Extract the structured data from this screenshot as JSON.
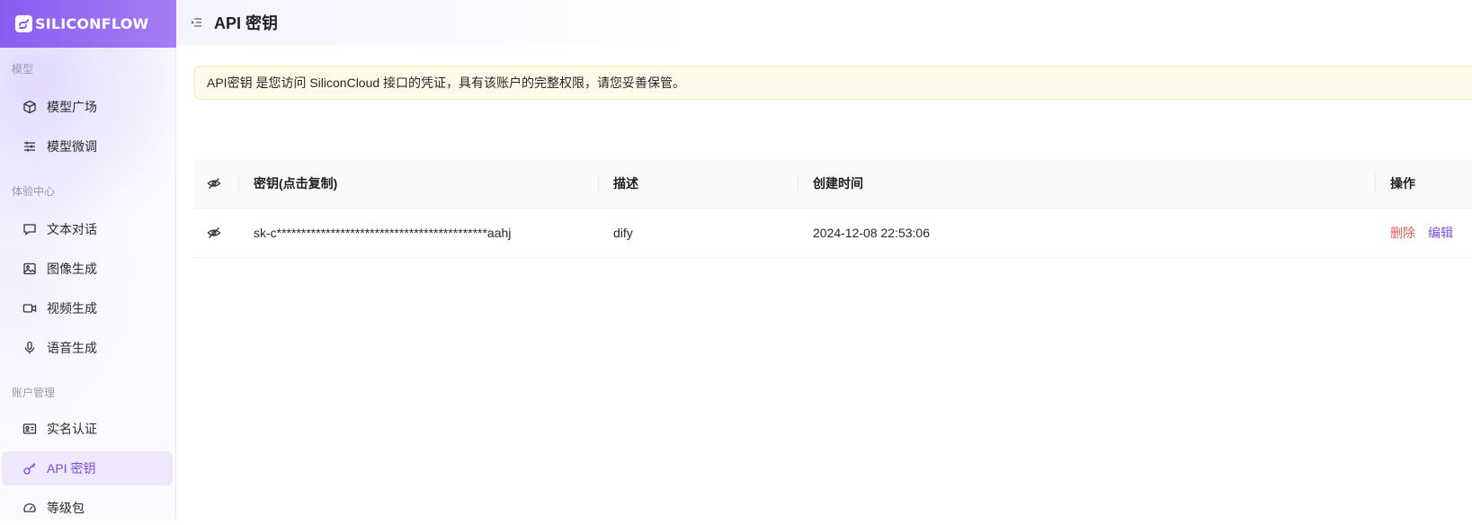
{
  "brand": {
    "name": "SILICONFLOW"
  },
  "sidebar": {
    "groups": [
      {
        "title": "模型",
        "items": [
          {
            "label": "模型广场",
            "icon": "cube-icon"
          },
          {
            "label": "模型微调",
            "icon": "sliders-icon"
          }
        ]
      },
      {
        "title": "体验中心",
        "items": [
          {
            "label": "文本对话",
            "icon": "chat-icon"
          },
          {
            "label": "图像生成",
            "icon": "image-icon"
          },
          {
            "label": "视频生成",
            "icon": "video-icon"
          },
          {
            "label": "语音生成",
            "icon": "microphone-icon"
          }
        ]
      },
      {
        "title": "账户管理",
        "items": [
          {
            "label": "实名认证",
            "icon": "id-card-icon"
          },
          {
            "label": "API 密钥",
            "icon": "key-icon",
            "active": true
          },
          {
            "label": "等级包",
            "icon": "gauge-icon"
          }
        ]
      }
    ]
  },
  "header": {
    "title": "API 密钥"
  },
  "notice": {
    "text": "API密钥 是您访问 SiliconCloud 接口的凭证，具有该账户的完整权限，请您妥善保管。"
  },
  "table": {
    "columns": [
      "密钥(点击复制)",
      "描述",
      "创建时间",
      "操作"
    ],
    "rows": [
      {
        "key": "sk-c*******************************************aahj",
        "description": "dify",
        "created": "2024-12-08 22:53:06",
        "actions": {
          "delete": "删除",
          "edit": "编辑"
        }
      }
    ]
  },
  "colors": {
    "accent": "#7a4ce0",
    "danger": "#e35a5a",
    "notice_bg": "#fffbea"
  }
}
